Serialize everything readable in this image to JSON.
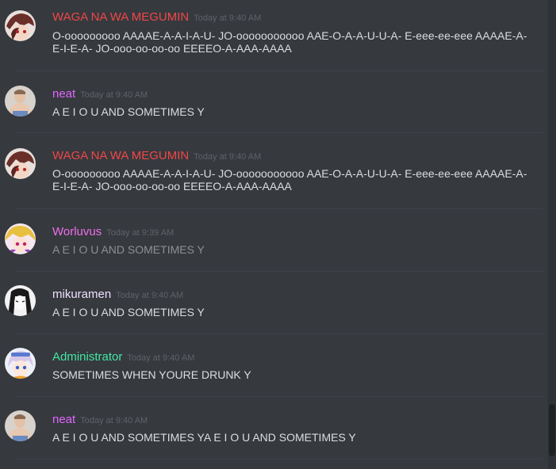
{
  "colors": {
    "background": "#36393e",
    "megumin": "#f04747",
    "neat": "#e066ff",
    "worluvus": "#f06ef0",
    "mikuramen": "#f0e0ff",
    "administrator": "#43e6a3"
  },
  "messages": [
    {
      "author": "WAGA NA WA MEGUMIN",
      "timestamp": "Today at 9:40 AM",
      "text": "O-ooooooooo AAAAE-A-A-I-A-U- JO-ooooooooooo AAE-O-A-A-U-U-A- E-eee-ee-eee AAAAE-A-E-I-E-A- JO-ooo-oo-oo-oo EEEEO-A-AAA-AAAA",
      "avatar_icon": "megumin-avatar-icon"
    },
    {
      "author": "neat",
      "timestamp": "Today at 9:40 AM",
      "text": "A E I O U AND SOMETIMES Y",
      "avatar_icon": "neat-avatar-icon"
    },
    {
      "author": "WAGA NA WA MEGUMIN",
      "timestamp": "Today at 9:40 AM",
      "text": "O-ooooooooo AAAAE-A-A-I-A-U- JO-ooooooooooo AAE-O-A-A-U-U-A- E-eee-ee-eee AAAAE-A-E-I-E-A- JO-ooo-oo-oo-oo EEEEO-A-AAA-AAAA",
      "avatar_icon": "megumin-avatar-icon"
    },
    {
      "author": "Worluvus",
      "timestamp": "Today at 9:39 AM",
      "text": "A E I O U AND SOMETIMES Y",
      "avatar_icon": "worluvus-avatar-icon"
    },
    {
      "author": "mikuramen",
      "timestamp": "Today at 9:40 AM",
      "text": "A E I O U AND SOMETIMES Y",
      "avatar_icon": "mikuramen-avatar-icon"
    },
    {
      "author": "Administrator",
      "timestamp": "Today at 9:40 AM",
      "text": "SOMETIMES WHEN YOURE DRUNK Y",
      "avatar_icon": "administrator-avatar-icon"
    },
    {
      "author": "neat",
      "timestamp": "Today at 9:40 AM",
      "text": "A E I O U AND SOMETIMES YA E I O U AND SOMETIMES Y",
      "avatar_icon": "neat-avatar-icon"
    }
  ]
}
